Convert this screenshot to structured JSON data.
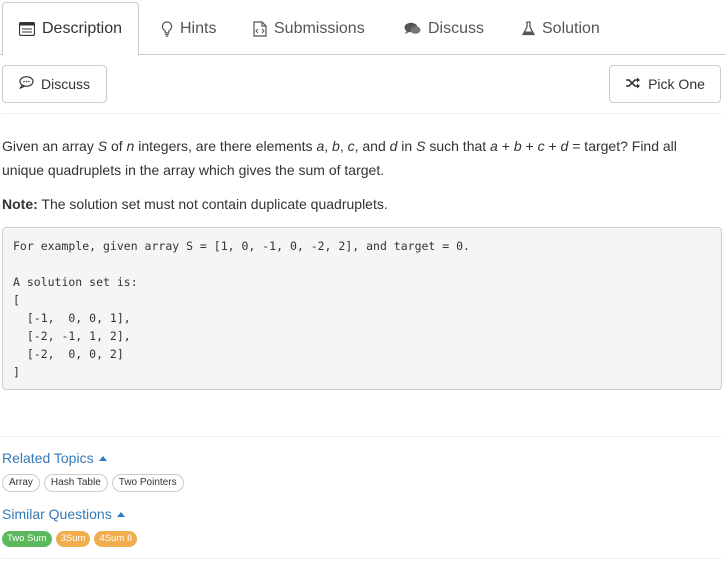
{
  "tabs": [
    {
      "label": "Description",
      "icon": "description-icon"
    },
    {
      "label": "Hints",
      "icon": "lightbulb-icon"
    },
    {
      "label": "Submissions",
      "icon": "code-file-icon"
    },
    {
      "label": "Discuss",
      "icon": "comments-icon"
    },
    {
      "label": "Solution",
      "icon": "flask-icon"
    }
  ],
  "toolbar": {
    "discuss_label": "Discuss",
    "pick_one_label": "Pick One"
  },
  "problem": {
    "description_html": "Given an array <i>S</i> of <i>n</i> integers, are there elements <i>a</i>, <i>b</i>, <i>c</i>, and <i>d</i> in <i>S</i> such that <i>a</i> + <i>b</i> + <i>c</i> + <i>d</i> = target? Find all unique quadruplets in the array which gives the sum of target.",
    "note_label": "Note:",
    "note_text": " The solution set must not contain duplicate quadruplets.",
    "example": "For example, given array S = [1, 0, -1, 0, -2, 2], and target = 0.\n\nA solution set is:\n[\n  [-1,  0, 0, 1],\n  [-2, -1, 1, 2],\n  [-2,  0, 0, 2]\n]"
  },
  "related_topics": {
    "title": "Related Topics",
    "items": [
      "Array",
      "Hash Table",
      "Two Pointers"
    ]
  },
  "similar_questions": {
    "title": "Similar Questions",
    "items": [
      {
        "label": "Two Sum",
        "difficulty_color": "#5cb85c"
      },
      {
        "label": "3Sum",
        "difficulty_color": "#f0ad4e"
      },
      {
        "label": "4Sum II",
        "difficulty_color": "#f0ad4e"
      }
    ]
  }
}
